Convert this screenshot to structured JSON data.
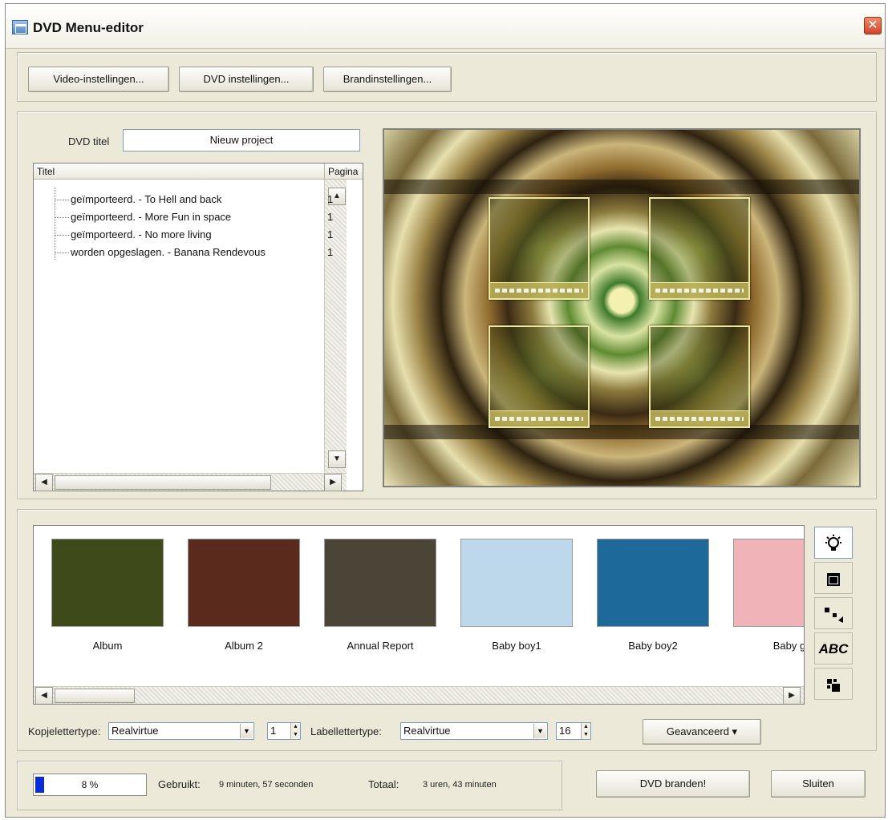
{
  "window": {
    "title": "DVD Menu-editor",
    "close_glyph": "✕"
  },
  "top_buttons": {
    "video": "Video-instellingen...",
    "dvd": "DVD instellingen...",
    "burn": "Brandinstellingen..."
  },
  "dvd_title": {
    "label": "DVD titel",
    "value": "Nieuw project"
  },
  "title_list": {
    "col_title": "Titel",
    "col_page": "Pagina",
    "rows": [
      {
        "title": "geïmporteerd. - To Hell and back",
        "page": "1"
      },
      {
        "title": "geïmporteerd. - More Fun in space",
        "page": "1"
      },
      {
        "title": "geïmporteerd. - No more living",
        "page": "1"
      },
      {
        "title": "worden opgeslagen. - Banana Rendevous",
        "page": "1"
      }
    ]
  },
  "templates": [
    {
      "name": "Album",
      "color": "#3f4a1a"
    },
    {
      "name": "Album 2",
      "color": "#5a2a1c"
    },
    {
      "name": "Annual Report",
      "color": "#4b4538"
    },
    {
      "name": "Baby boy1",
      "color": "#bcd8ea"
    },
    {
      "name": "Baby boy2",
      "color": "#1d6a9a"
    },
    {
      "name": "Baby g",
      "color": "#efb3b8"
    }
  ],
  "tools": [
    "bulb-icon",
    "frame-icon",
    "arrows-icon",
    "text-icon",
    "grid-icon"
  ],
  "tool_glyphs": {
    "text": "ABC"
  },
  "font_settings": {
    "title_font_label": "Kopjelettertype:",
    "title_font_value": "Realvirtue",
    "title_size": "1",
    "label_font_label": "Labellettertype:",
    "label_font_value": "Realvirtue",
    "label_size": "16",
    "advanced_button": "Geavanceerd ▾"
  },
  "status": {
    "progress_percent": 8,
    "progress_text": "8 %",
    "used_label": "Gebruikt:",
    "used_value": "9 minuten, 57 seconden",
    "total_label": "Totaal:",
    "total_value": "3 uren, 43 minuten"
  },
  "bottom_buttons": {
    "burn": "DVD branden!",
    "close": "Sluiten"
  }
}
